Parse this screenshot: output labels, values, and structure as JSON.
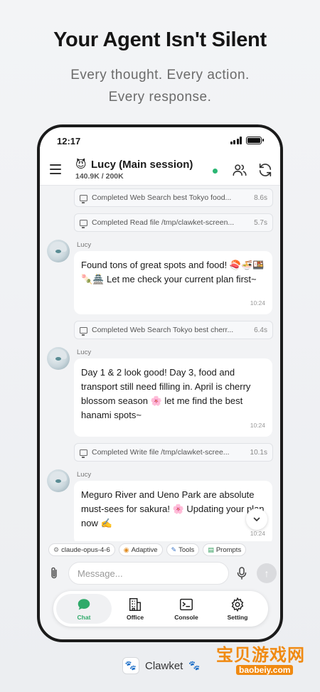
{
  "hero": {
    "title": "Your Agent Isn't Silent",
    "subtitle_line1": "Every thought. Every action.",
    "subtitle_line2": "Every response."
  },
  "statusbar": {
    "time": "12:17"
  },
  "header": {
    "session_emoji": "😈",
    "title": "Lucy (Main session)",
    "tokens": "140.9K / 200K",
    "status_color": "#2bb673"
  },
  "messages": {
    "tool1": {
      "text": "Completed Web Search best Tokyo food...",
      "duration": "8.6s"
    },
    "tool2": {
      "text": "Completed Read file /tmp/clawket-screen...",
      "duration": "5.7s"
    },
    "msg1": {
      "sender": "Lucy",
      "text": "Found tons of great spots and food! 🍣🍜🍱🍡🏯 Let me check your current plan first~",
      "time": "10:24"
    },
    "tool3": {
      "text": "Completed Web Search Tokyo best cherr...",
      "duration": "6.4s"
    },
    "msg2": {
      "sender": "Lucy",
      "text": "Day 1 & 2 look good! Day 3, food and transport still need filling in. April is cherry blossom season 🌸 let me find the best hanami spots~",
      "time": "10:24"
    },
    "tool4": {
      "text": "Completed Write file /tmp/clawket-scree...",
      "duration": "10.1s"
    },
    "msg3": {
      "sender": "Lucy",
      "text": "Meguro River and Ueno Park are absolute must-sees for sakura! 🌸 Updating your plan now ✍️",
      "time": "10:24"
    }
  },
  "chips": {
    "model": "claude-opus-4-6",
    "adaptive": "Adaptive",
    "tools": "Tools",
    "prompts": "Prompts"
  },
  "composer": {
    "placeholder": "Message..."
  },
  "tabs": {
    "chat": "Chat",
    "office": "Office",
    "console": "Console",
    "setting": "Setting"
  },
  "footer": {
    "app_name": "Clawket"
  },
  "watermark": {
    "text": "宝贝游戏网",
    "url": "baobeiy.com"
  },
  "colors": {
    "accent": "#2faa6a",
    "watermark": "#f08a12"
  }
}
